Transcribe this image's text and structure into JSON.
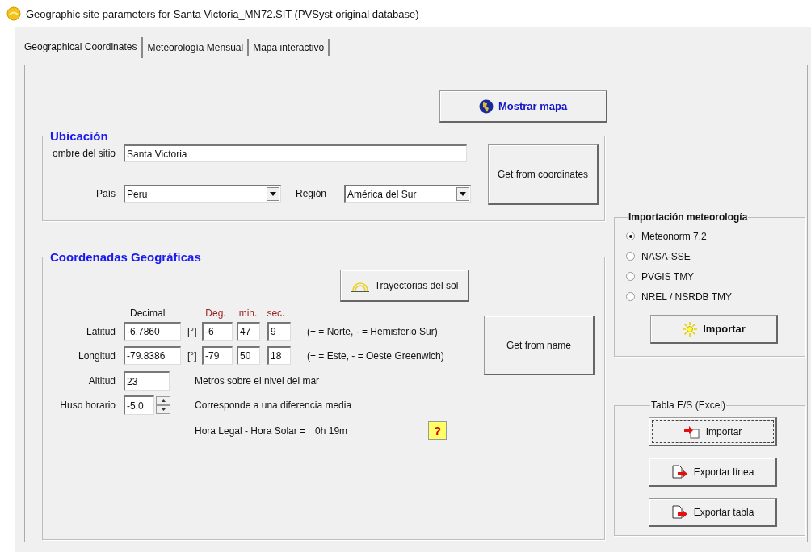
{
  "window": {
    "title": "Geographic site parameters for Santa Victoria_MN72.SIT (PVSyst original database)"
  },
  "tabs": [
    {
      "label": "Geographical Coordinates",
      "selected": true
    },
    {
      "label": "Meteorología Mensual",
      "selected": false
    },
    {
      "label": "Mapa interactivo",
      "selected": false
    }
  ],
  "map_button": {
    "label": "Mostrar mapa"
  },
  "location": {
    "title": "Ubicación",
    "site_name": {
      "label": "ombre del sitio",
      "value": "Santa Victoria"
    },
    "country": {
      "label": "País",
      "value": "Peru"
    },
    "region": {
      "label": "Región",
      "value": "América del Sur"
    },
    "button": "Get from coordinates"
  },
  "coordinates": {
    "title": "Coordenadas Geográficas",
    "sun_paths_button": "Trayectorias del sol",
    "headers": {
      "decimal": "Decimal",
      "deg": "Deg.",
      "min": "min.",
      "sec": "sec."
    },
    "rows": [
      {
        "label": "Latitud",
        "decimal": "-6.7860",
        "unit": "[°]",
        "deg": "-6",
        "min": "47",
        "sec": "9",
        "note": "(+ = Norte, - = Hemisferio Sur)"
      },
      {
        "label": "Longitud",
        "decimal": "-79.8386",
        "unit": "[°]",
        "deg": "-79",
        "min": "50",
        "sec": "18",
        "note": "(+ = Este, - = Oeste Greenwich)"
      }
    ],
    "altitude": {
      "label": "Altitud",
      "value": "23",
      "note": "Metros sobre el nivel del mar"
    },
    "timezone": {
      "label": "Huso horario",
      "value": "-5.0",
      "note": "Corresponde a una diferencia media"
    },
    "legal_solar": {
      "label": "Hora Legal - Hora Solar =",
      "value": "0h 19m"
    },
    "help_button": "?",
    "button": "Get from name"
  },
  "meteo_import": {
    "title": "Importación meteorología",
    "sources": [
      {
        "label": "Meteonorm 7.2",
        "selected": true
      },
      {
        "label": "NASA-SSE",
        "selected": false
      },
      {
        "label": "PVGIS TMY",
        "selected": false
      },
      {
        "label": "NREL / NSRDB TMY",
        "selected": false
      }
    ],
    "button": "Importar"
  },
  "excel_table": {
    "title": "Tabla E/S (Excel)",
    "buttons": [
      {
        "kind": "import",
        "label": "Importar",
        "focused": true
      },
      {
        "kind": "export",
        "label": "Exportar línea",
        "focused": false
      },
      {
        "kind": "export",
        "label": "Exportar tabla",
        "focused": false
      }
    ]
  }
}
